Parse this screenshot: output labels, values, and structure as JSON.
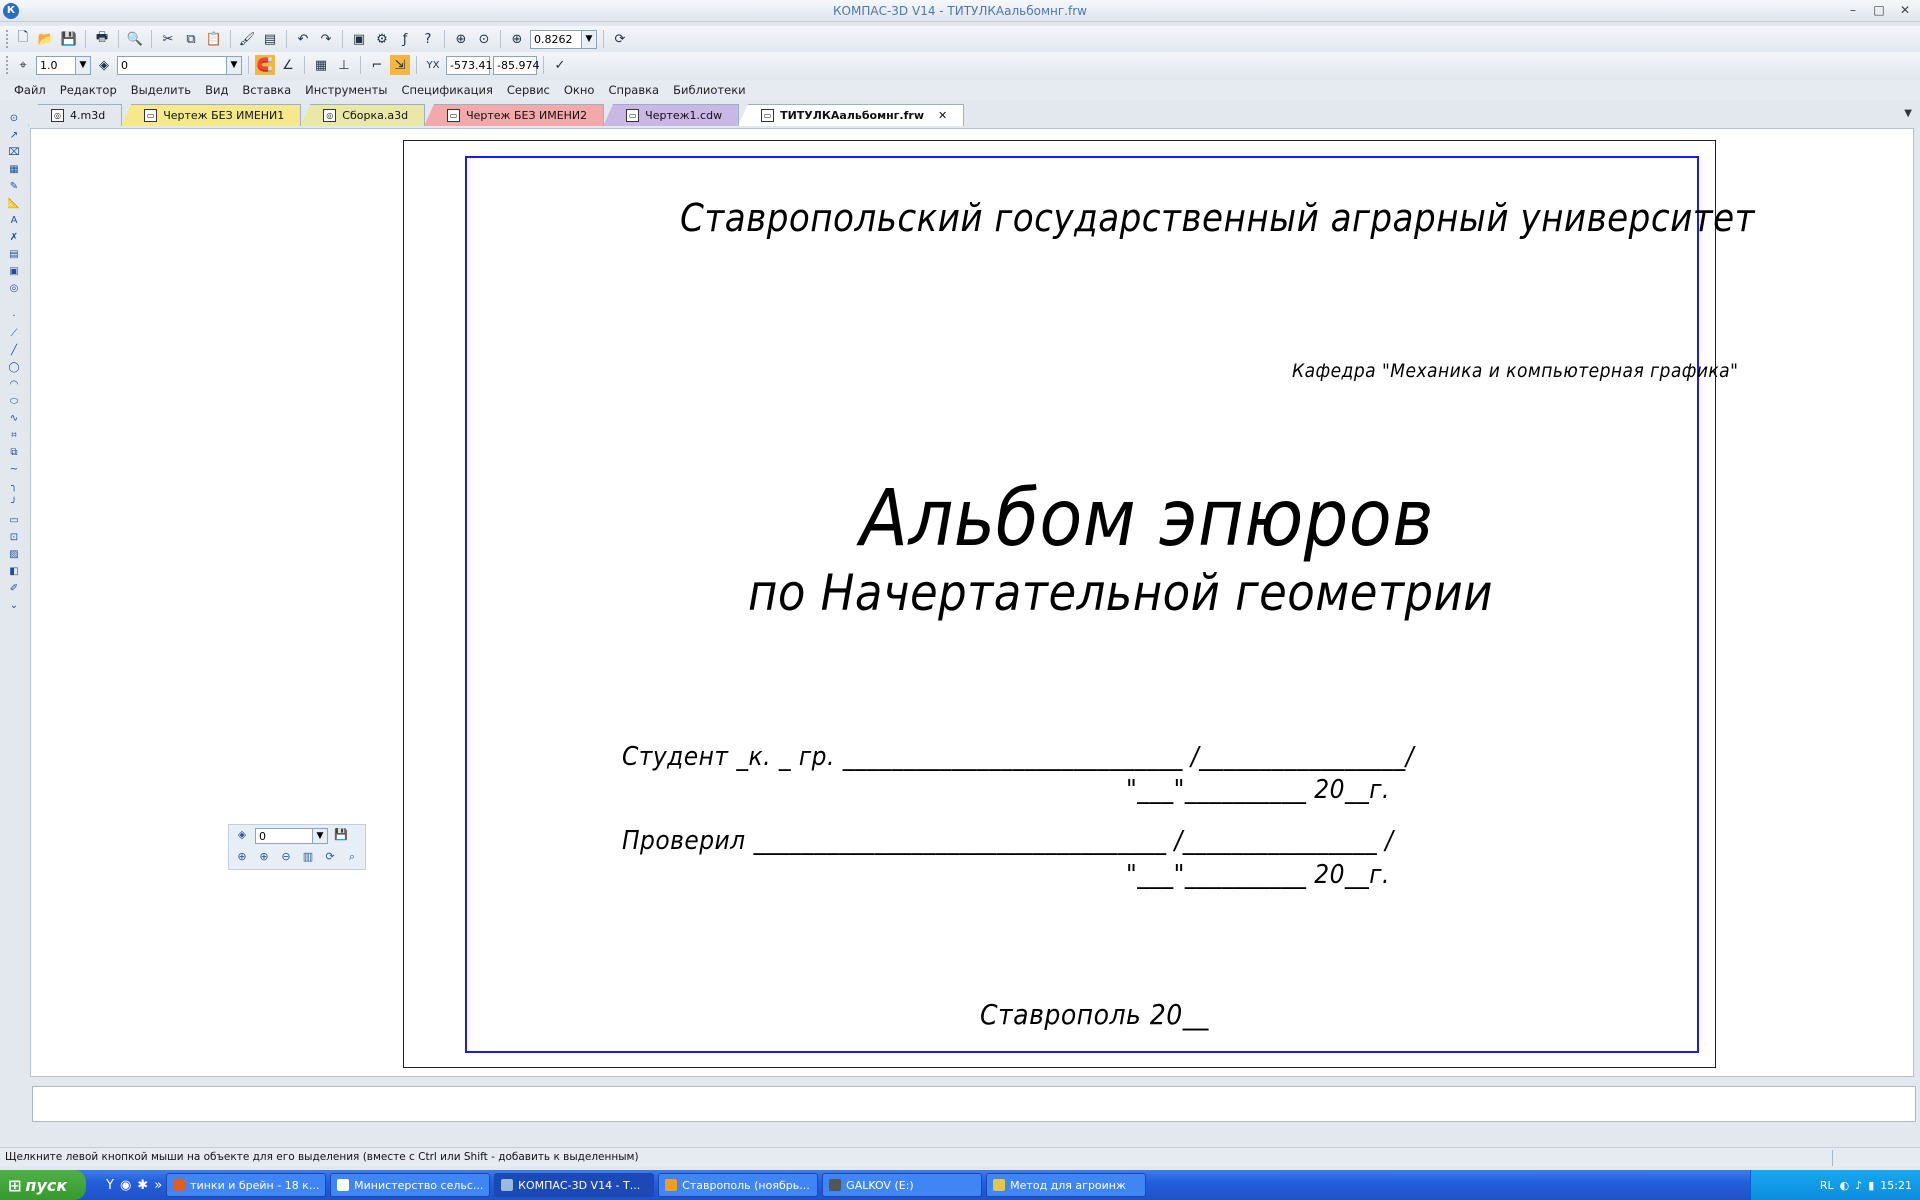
{
  "window": {
    "title": "КОМПАС-3D V14 - ТИТУЛКАальбомнг.frw",
    "app_icon": "К",
    "minimize": "–",
    "maximize": "□",
    "close": "✕"
  },
  "toolbar1": {
    "zoom_value": "0.8262"
  },
  "toolbar2": {
    "step_value": "1.0",
    "layer_value": "0",
    "coord_x": "-573.41",
    "coord_y": "-85.974"
  },
  "menu": [
    "Файл",
    "Редактор",
    "Выделить",
    "Вид",
    "Вставка",
    "Инструменты",
    "Спецификация",
    "Сервис",
    "Окно",
    "Справка",
    "Библиотеки"
  ],
  "tabs": [
    {
      "label": "4.m3d",
      "color": "#e3e8ee"
    },
    {
      "label": "Чертеж БЕЗ ИМЕНИ1",
      "color": "#f6e98c"
    },
    {
      "label": "Сборка.a3d",
      "color": "#e9e8a6"
    },
    {
      "label": "Чертеж БЕЗ ИМЕНИ2",
      "color": "#f3a9a9"
    },
    {
      "label": "Чертеж1.cdw",
      "color": "#c9b7e6"
    },
    {
      "label": "ТИТУЛКАальбомнг.frw",
      "color": "#ffffff"
    }
  ],
  "document": {
    "university": "Ставропольский государственный аграрный университет",
    "department": "Кафедра \"Механика и компьютерная графика\"",
    "title": "Альбом эпюров",
    "subtitle": "по Начертательной геометрии",
    "student_line": "Студент _к. _ гр. ____________________________ /_________________/",
    "date_line_1": "\"___\"__________ 20__г.",
    "checked_line": "Проверил __________________________________ /________________ /",
    "date_line_2": "\"___\"__________ 20__г.",
    "city": "Ставрополь 20__"
  },
  "float_panel": {
    "layer_value": "0"
  },
  "status": {
    "hint": "Щелкните левой кнопкой мыши на объекте для его выделения (вместе с Ctrl или Shift - добавить к выделенным)"
  },
  "taskbar": {
    "start": "пуск",
    "tasks": [
      {
        "label": "тинки и брейн - 18 к..."
      },
      {
        "label": "Министерство сельс..."
      },
      {
        "label": "КОМПАС-3D V14 - Т..."
      },
      {
        "label": "Ставрополь (ноябрь..."
      },
      {
        "label": "GALKOV (E:)"
      },
      {
        "label": "Метод для агроинж"
      }
    ],
    "lang": "RL",
    "clock": "15:21"
  }
}
